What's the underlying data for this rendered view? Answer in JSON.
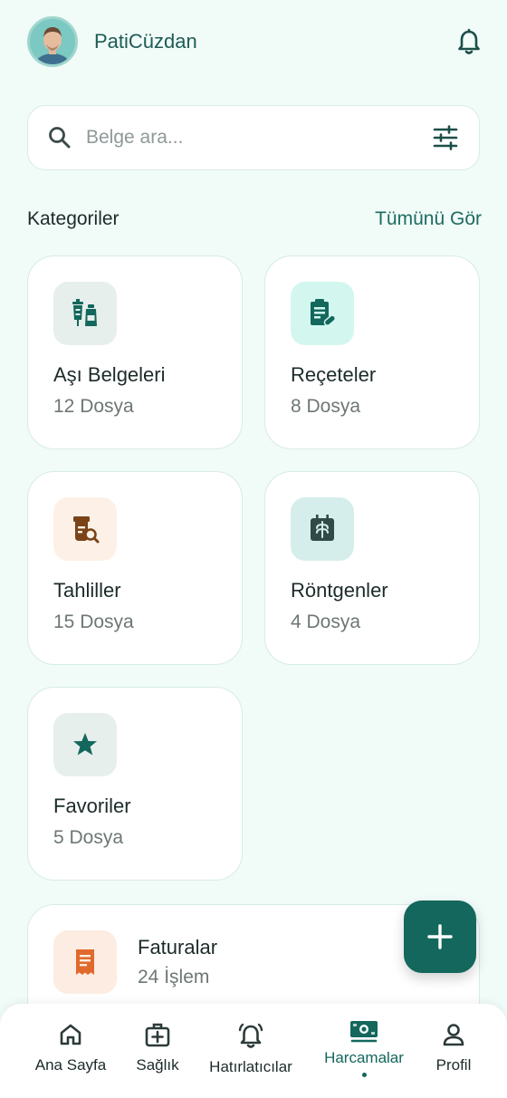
{
  "header": {
    "app_title": "PatiCüzdan"
  },
  "search": {
    "placeholder": "Belge ara..."
  },
  "categories_section": {
    "title": "Kategoriler",
    "see_all": "Tümünü Gör"
  },
  "categories": [
    {
      "title": "Aşı Belgeleri",
      "count": "12 Dosya",
      "icon": "vaccine-icon",
      "bg": "#e6efec",
      "color": "#13675c"
    },
    {
      "title": "Reçeteler",
      "count": "8 Dosya",
      "icon": "prescription-icon",
      "bg": "#d3f7ef",
      "color": "#13675c"
    },
    {
      "title": "Tahliller",
      "count": "15 Dosya",
      "icon": "lab-test-icon",
      "bg": "#fdf1e7",
      "color": "#7a4418"
    },
    {
      "title": "Röntgenler",
      "count": "4 Dosya",
      "icon": "xray-icon",
      "bg": "#d6eeeb",
      "color": "#2f4a47"
    },
    {
      "title": "Favoriler",
      "count": "5 Dosya",
      "icon": "star-icon",
      "bg": "#e6efec",
      "color": "#13675c"
    }
  ],
  "invoice": {
    "title": "Faturalar",
    "count": "24 İşlem",
    "icon": "receipt-icon",
    "bg": "#fdece1",
    "color": "#e06a2c"
  },
  "bottom_nav": [
    {
      "label": "Ana Sayfa",
      "icon": "home-icon"
    },
    {
      "label": "Sağlık",
      "icon": "medical-kit-icon"
    },
    {
      "label": "Hatırlatıcılar",
      "icon": "alarm-bell-icon"
    },
    {
      "label": "Harcamalar",
      "icon": "money-icon",
      "active": true
    },
    {
      "label": "Profil",
      "icon": "person-icon"
    }
  ],
  "colors": {
    "accent": "#13675c",
    "background": "#f1fbf8"
  }
}
